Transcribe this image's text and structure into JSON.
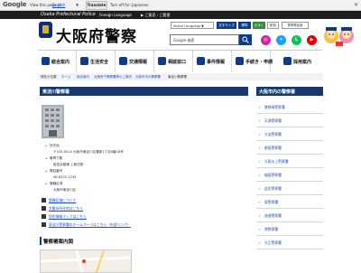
{
  "translate_bar": {
    "logo": "Google",
    "view_label": "View this page in:",
    "language": "English",
    "arrow": "▼",
    "translate_btn": "Translate",
    "shows_text": "Turn off for: Japanese",
    "close": "✕"
  },
  "top_strip": {
    "site_en": "Osaka Prefectural Police",
    "foreign_language": "Foreign Language",
    "vision_link": "▶ ご意見・ご要望"
  },
  "header": {
    "site_title": "大阪府警察",
    "select_language": "Select Language ▼",
    "furigana": "文字サイズ",
    "voice": "標準",
    "text_large": "大きく",
    "text_standard": "配色",
    "mobile": "携帯電話版",
    "search_placeholder": "Google 検索",
    "sns": [
      "ig",
      "tw",
      "line",
      "yt"
    ]
  },
  "nav": {
    "items": [
      {
        "label": "総合案内"
      },
      {
        "label": "生活安全"
      },
      {
        "label": "交通情報"
      },
      {
        "label": "相談窓口"
      },
      {
        "label": "事件情報"
      },
      {
        "label": "手続き・申請"
      },
      {
        "label": "採用案内"
      }
    ]
  },
  "breadcrumb": [
    "現在の位置",
    "ホーム",
    "総合案内",
    "大阪府下警察署等のご案内",
    "大阪市内の警察署",
    "東淀川警察署"
  ],
  "main": {
    "title": "東淀川警察署",
    "info": [
      "所在地",
      "〒533-0014 大阪市東淀川区豊新1丁目8番18号",
      "最寄り駅",
      "阪急京都線 上新庄駅",
      "電話番号",
      "06-6325-1234",
      "管轄区域",
      "大阪市東淀川区"
    ],
    "links": [
      "管轄区域について",
      "交番の所在地はこちら",
      "防犯情報マップはこちら",
      "東淀川警察署のホームページはこちら（外部リンク）"
    ],
    "map_title": "警察署案内図"
  },
  "sidebar": {
    "title": "大阪市内の警察署",
    "items": [
      "曽根崎警察署",
      "天満警察署",
      "大淀警察署",
      "都島警察署",
      "大阪水上警察署",
      "福島警察署",
      "此花警察署",
      "東警察署",
      "浪速警察署",
      "港警察署",
      "大正警察署"
    ]
  },
  "colors": {
    "navy": "#17386f",
    "accent_blue": "#0c3b8c",
    "link": "#1a4fc4",
    "green": "#2f8f3e"
  }
}
